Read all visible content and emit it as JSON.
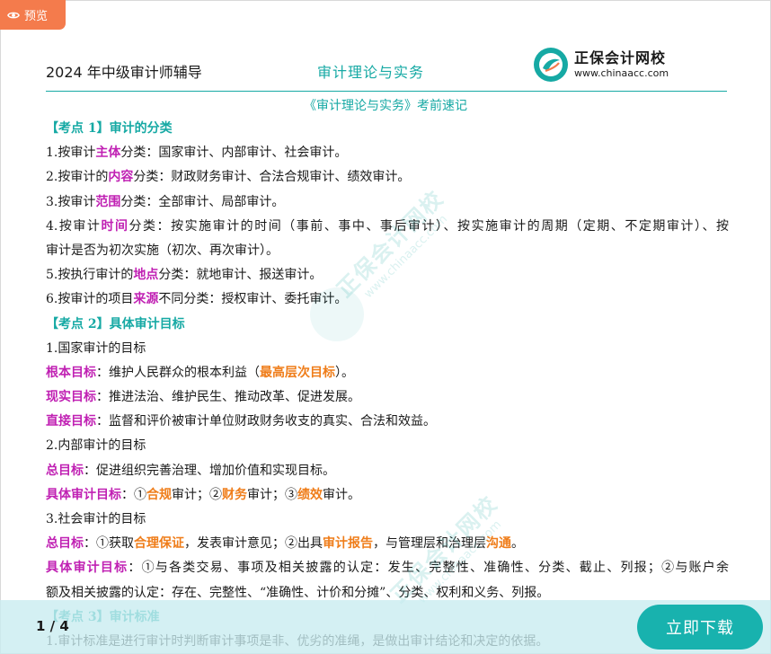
{
  "preview_tab": {
    "label": "预览",
    "icon": "eye-icon"
  },
  "header": {
    "left": "2024 年中级审计师辅导",
    "center": "审计理论与实务",
    "logo_cn": "正保会计网校",
    "logo_url": "www.chinaacc.com"
  },
  "doc_title": "《审计理论与实务》考前速记",
  "lines": [
    [
      {
        "t": "【考点 1】审计的分类",
        "c": "sec"
      }
    ],
    [
      {
        "t": "1.按审计"
      },
      {
        "t": "主体",
        "c": "m"
      },
      {
        "t": "分类：国家审计、内部审计、社会审计。"
      }
    ],
    [
      {
        "t": "2.按审计的"
      },
      {
        "t": "内容",
        "c": "m"
      },
      {
        "t": "分类：财政财务审计、合法合规审计、绩效审计。"
      }
    ],
    [
      {
        "t": "3.按审计"
      },
      {
        "t": "范围",
        "c": "m"
      },
      {
        "t": "分类：全部审计、局部审计。"
      }
    ],
    [
      {
        "t": "4.按审计"
      },
      {
        "t": "时间",
        "c": "m"
      },
      {
        "t": "分类：按实施审计的时间（事前、事中、事后审计）、按实施审计的周期（定期、不定期审计）、按"
      }
    ],
    [
      {
        "t": "审计是否为初次实施（初次、再次审计）。"
      }
    ],
    [
      {
        "t": "5.按执行审计的"
      },
      {
        "t": "地点",
        "c": "m"
      },
      {
        "t": "分类：就地审计、报送审计。"
      }
    ],
    [
      {
        "t": "6.按审计的项目"
      },
      {
        "t": "来源",
        "c": "m"
      },
      {
        "t": "不同分类：授权审计、委托审计。"
      }
    ],
    [
      {
        "t": "【考点 2】具体审计目标",
        "c": "sec"
      }
    ],
    [
      {
        "t": "1.国家审计的目标"
      }
    ],
    [
      {
        "t": "根本目标",
        "c": "m"
      },
      {
        "t": "：维护人民群众的根本利益（"
      },
      {
        "t": "最高层次目标",
        "c": "o"
      },
      {
        "t": "）。"
      }
    ],
    [
      {
        "t": "现实目标",
        "c": "m"
      },
      {
        "t": "：推进法治、维护民生、推动改革、促进发展。"
      }
    ],
    [
      {
        "t": "直接目标",
        "c": "m"
      },
      {
        "t": "：监督和评价被审计单位财政财务收支的真实、合法和效益。"
      }
    ],
    [
      {
        "t": "2.内部审计的目标"
      }
    ],
    [
      {
        "t": "总目标",
        "c": "m"
      },
      {
        "t": "：促进组织完善治理、增加价值和实现目标。"
      }
    ],
    [
      {
        "t": "具体审计目标",
        "c": "m"
      },
      {
        "t": "：①"
      },
      {
        "t": "合规",
        "c": "o"
      },
      {
        "t": "审计；②"
      },
      {
        "t": "财务",
        "c": "o"
      },
      {
        "t": "审计；③"
      },
      {
        "t": "绩效",
        "c": "o"
      },
      {
        "t": "审计。"
      }
    ],
    [
      {
        "t": "3.社会审计的目标"
      }
    ],
    [
      {
        "t": "总目标",
        "c": "m"
      },
      {
        "t": "：①获取"
      },
      {
        "t": "合理保证",
        "c": "o"
      },
      {
        "t": "，发表审计意见；②出具"
      },
      {
        "t": "审计报告",
        "c": "o"
      },
      {
        "t": "，与管理层和治理层"
      },
      {
        "t": "沟通",
        "c": "o"
      },
      {
        "t": "。"
      }
    ],
    [
      {
        "t": "具体审计目标",
        "c": "m"
      },
      {
        "t": "：①与各类交易、事项及相关披露的认定：发生、完整性、准确性、分类、截止、列报；②与账户余"
      }
    ],
    [
      {
        "t": "额及相关披露的认定：存在、完整性、“准确性、计价和分摊”、分类、权利和义务、列报。"
      }
    ],
    [
      {
        "t": "【考点 3】审计标准",
        "c": "sec"
      }
    ],
    [
      {
        "t": "1.审计标准是进行审计时判断审计事项是非、优劣的准绳，是做出审计结论和决定的依据。"
      }
    ]
  ],
  "watermark": {
    "brand": "正保会计网校",
    "url": "www.chinaacc.com"
  },
  "page_indicator": "1 / 4",
  "download_button": "立即下载",
  "colors": {
    "accent_teal": "#16a9a4",
    "keyword_magenta": "#c021b3",
    "keyword_orange": "#ef7d1a",
    "preview_tab": "#f47b4c",
    "download_button": "#18b2ae"
  }
}
